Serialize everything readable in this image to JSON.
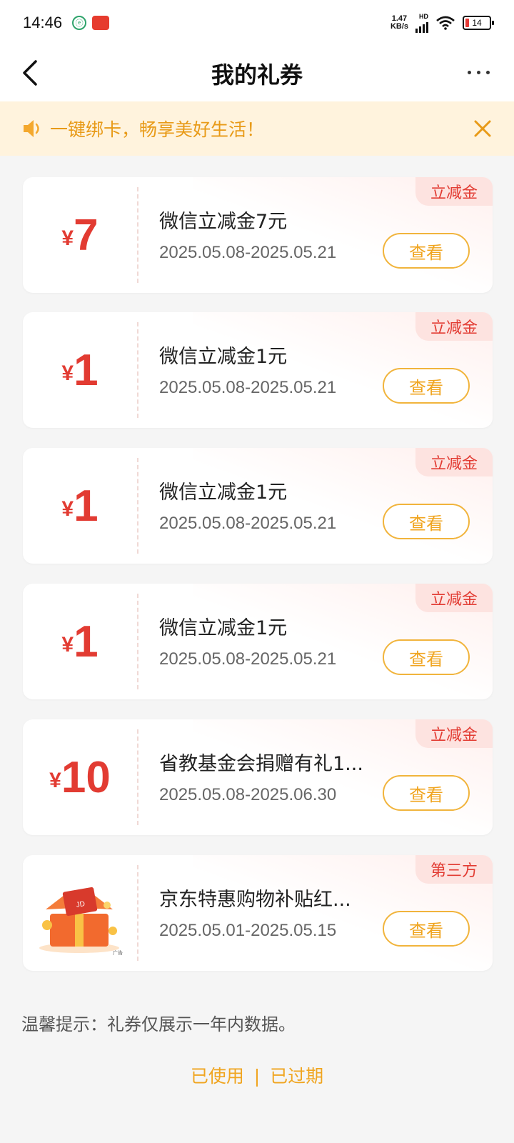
{
  "status_bar": {
    "time": "14:46",
    "app_icon_text": "ⓔ",
    "app2_text": "",
    "net_speed_value": "1.47",
    "net_speed_unit": "KB/s",
    "hd": "HD",
    "battery": "14"
  },
  "nav": {
    "title": "我的礼券"
  },
  "notice": {
    "text": "一键绑卡，畅享美好生活！"
  },
  "coupons": [
    {
      "yen": "¥",
      "amount": "7",
      "name": "微信立减金7元",
      "date": "2025.05.08-2025.05.21",
      "tag": "立减金",
      "button": "查看"
    },
    {
      "yen": "¥",
      "amount": "1",
      "name": "微信立减金1元",
      "date": "2025.05.08-2025.05.21",
      "tag": "立减金",
      "button": "查看"
    },
    {
      "yen": "¥",
      "amount": "1",
      "name": "微信立减金1元",
      "date": "2025.05.08-2025.05.21",
      "tag": "立减金",
      "button": "查看"
    },
    {
      "yen": "¥",
      "amount": "1",
      "name": "微信立减金1元",
      "date": "2025.05.08-2025.05.21",
      "tag": "立减金",
      "button": "查看"
    },
    {
      "yen": "¥",
      "amount": "10",
      "name": "省教基金会捐赠有礼1...",
      "date": "2025.05.08-2025.06.30",
      "tag": "立减金",
      "button": "查看"
    },
    {
      "name": "京东特惠购物补贴红...",
      "date": "2025.05.01-2025.05.15",
      "tag": "第三方",
      "button": "查看",
      "image_label": "广告",
      "image_badge": "JD"
    }
  ],
  "tip": "温馨提示：礼券仅展示一年内数据。",
  "links": {
    "used": "已使用",
    "separator": "|",
    "expired": "已过期"
  },
  "colors": {
    "accent_red": "#e23b32",
    "accent_orange": "#f0a520",
    "notice_bg": "#fff3dd"
  }
}
